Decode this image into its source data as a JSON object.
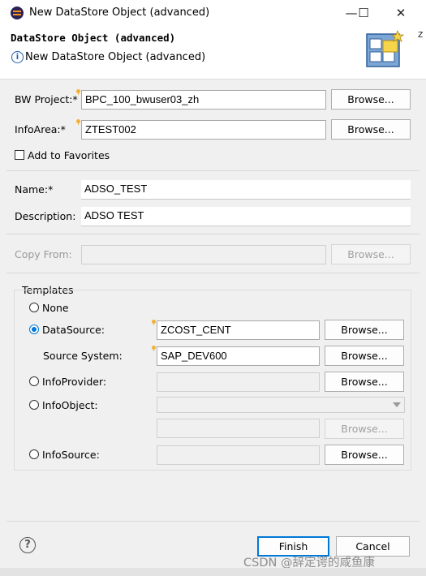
{
  "window": {
    "title": "New DataStore Object (advanced)",
    "controls": {
      "minimize": "—",
      "maximize": "☐",
      "close": "✕"
    }
  },
  "header": {
    "title": "DataStore Object (advanced)",
    "message": "New DataStore Object (advanced)",
    "info_icon_glyph": "i",
    "cut_text": "z"
  },
  "form": {
    "bw_project": {
      "label": "BW Project:*",
      "value": "BPC_100_bwuser03_zh",
      "button": "Browse..."
    },
    "infoarea": {
      "label": "InfoArea:*",
      "value": "ZTEST002",
      "button": "Browse..."
    },
    "add_to_favorites": {
      "label": "Add to Favorites",
      "checked": false
    },
    "name": {
      "label": "Name:*",
      "value": "ADSO_TEST"
    },
    "description": {
      "label": "Description:",
      "value": "ADSO TEST"
    },
    "copy_from": {
      "label": "Copy From:",
      "value": "",
      "button": "Browse...",
      "enabled": false
    }
  },
  "templates": {
    "legend": "Templates",
    "none": {
      "label": "None",
      "selected": false
    },
    "datasource": {
      "label": "DataSource:",
      "value": "ZCOST_CENT",
      "button": "Browse...",
      "selected": true
    },
    "source_system": {
      "label": "Source System:",
      "value": "SAP_DEV600",
      "button": "Browse..."
    },
    "infoprovider": {
      "label": "InfoProvider:",
      "value": "",
      "button": "Browse...",
      "selected": false
    },
    "infoobject": {
      "label": "InfoObject:",
      "value": "",
      "button": "Browse...",
      "selected": false
    },
    "infosource": {
      "label": "InfoSource:",
      "value": "",
      "button": "Browse...",
      "selected": false
    }
  },
  "footer": {
    "help_glyph": "?",
    "finish": "Finish",
    "cancel": "Cancel",
    "watermark": "CSDN @辞定谔的咸鱼康"
  },
  "colors": {
    "accent": "#0078d7",
    "decorator": "#f2b137",
    "info": "#1c5fb2"
  }
}
